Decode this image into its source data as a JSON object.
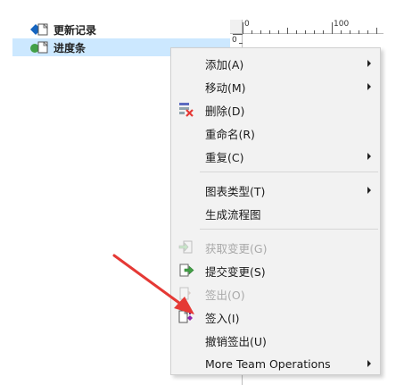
{
  "tree": {
    "items": [
      {
        "label": "更新记录"
      },
      {
        "label": "进度条"
      }
    ]
  },
  "ruler": {
    "top_labels": [
      "0",
      "100"
    ],
    "left_labels": [
      "0"
    ]
  },
  "context_menu": {
    "items": [
      {
        "label": "添加(A)",
        "submenu": true,
        "enabled": true
      },
      {
        "label": "移动(M)",
        "submenu": true,
        "enabled": true
      },
      {
        "label": "删除(D)",
        "submenu": false,
        "enabled": true,
        "icon": "delete-icon"
      },
      {
        "label": "重命名(R)",
        "submenu": false,
        "enabled": true
      },
      {
        "label": "重复(C)",
        "submenu": true,
        "enabled": true
      },
      {
        "label": "图表类型(T)",
        "submenu": true,
        "enabled": true
      },
      {
        "label": "生成流程图",
        "submenu": false,
        "enabled": true
      },
      {
        "label": "获取变更(G)",
        "submenu": false,
        "enabled": false,
        "icon": "get-changes-icon"
      },
      {
        "label": "提交变更(S)",
        "submenu": false,
        "enabled": true,
        "icon": "commit-changes-icon"
      },
      {
        "label": "签出(O)",
        "submenu": false,
        "enabled": false,
        "icon": "checkout-icon"
      },
      {
        "label": "签入(I)",
        "submenu": false,
        "enabled": true,
        "icon": "checkin-icon"
      },
      {
        "label": "撤销签出(U)",
        "submenu": false,
        "enabled": true
      },
      {
        "label": "More Team Operations",
        "submenu": true,
        "enabled": true
      }
    ]
  },
  "colors": {
    "selection": "#cce8ff",
    "menu_bg": "#f2f2f2",
    "annotation_arrow": "#e53935"
  }
}
